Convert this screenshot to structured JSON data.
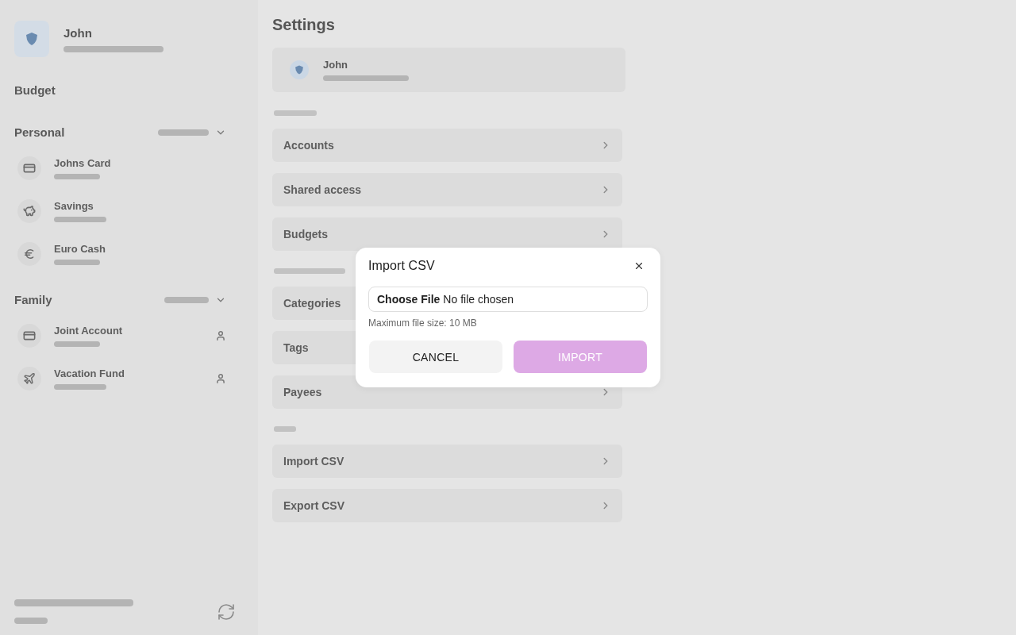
{
  "sidebar": {
    "profile": {
      "name": "John"
    },
    "heading": "Budget",
    "groups": [
      {
        "title": "Personal",
        "expanded": true,
        "accounts": [
          {
            "name": "Johns Card",
            "kind": "card",
            "shared": false
          },
          {
            "name": "Savings",
            "kind": "savings",
            "shared": false
          },
          {
            "name": "Euro Cash",
            "kind": "cash",
            "shared": false
          }
        ]
      },
      {
        "title": "Family",
        "expanded": true,
        "accounts": [
          {
            "name": "Joint Account",
            "kind": "card",
            "shared": true
          },
          {
            "name": "Vacation Fund",
            "kind": "travel",
            "shared": true
          }
        ]
      }
    ]
  },
  "page": {
    "title": "Settings",
    "profile": {
      "name": "John"
    },
    "sections": [
      {
        "items": [
          "Accounts",
          "Shared access",
          "Budgets"
        ]
      },
      {
        "items": [
          "Categories",
          "Tags",
          "Payees"
        ]
      },
      {
        "items": [
          "Import CSV",
          "Export CSV"
        ]
      }
    ]
  },
  "modal": {
    "title": "Import CSV",
    "file_field": {
      "button": "Choose File",
      "value": "No file chosen"
    },
    "hint": "Maximum file size: 10 MB",
    "buttons": [
      {
        "label": "CANCEL",
        "kind": "secondary",
        "disabled": false
      },
      {
        "label": "IMPORT",
        "kind": "primary",
        "disabled": true
      }
    ]
  }
}
